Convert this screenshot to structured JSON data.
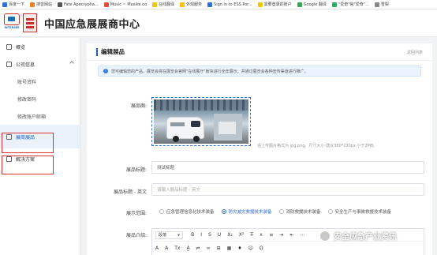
{
  "bookmarks": [
    {
      "label": "百度一下",
      "color": "#2d6fe0",
      "icon": "baidu-icon"
    },
    {
      "label": "搜音网站",
      "color": "#e67e22",
      "icon": "site-icon"
    },
    {
      "label": "Fate Apocrypha...",
      "color": "#555555",
      "icon": "page-icon"
    },
    {
      "label": "Music ~ Musike.co",
      "color": "#e74c3c",
      "icon": "music-icon"
    },
    {
      "label": "在线翻译",
      "color": "#f1c40f",
      "icon": "folder-icon"
    },
    {
      "label": "外观服务",
      "color": "#f1c40f",
      "icon": "folder-icon"
    },
    {
      "label": "Sign in to ESS Por...",
      "color": "#2d6fe0",
      "icon": "signin-icon"
    },
    {
      "label": "需要登录的账户",
      "color": "#f1c40f",
      "icon": "folder-icon"
    },
    {
      "label": "Google 翻译",
      "color": "#34a853",
      "icon": "google-icon"
    },
    {
      "label": "\"爱奇\"官\"爱奇\"...",
      "color": "#27ae60",
      "icon": "video-icon"
    },
    {
      "label": "雪梨",
      "color": "#888888",
      "icon": "page-icon"
    }
  ],
  "header": {
    "logo_text": "INTERSEE",
    "site_title": "中国应急展展商中心"
  },
  "sidebar": {
    "items": [
      {
        "label": "概览"
      },
      {
        "label": "公司信息"
      },
      {
        "label": "账号资料"
      },
      {
        "label": "修改密码"
      },
      {
        "label": "修改账户邮箱"
      },
      {
        "label": "展商展品"
      },
      {
        "label": "解决方案"
      }
    ]
  },
  "page": {
    "title": "编辑展品",
    "back_link": "返回列表",
    "notice": "您可编辑您的产品，展览会将在展览会官网\"在线展厅\"板块进行全年展示；并通过展览会各种宣传渠道进行推广。"
  },
  "form": {
    "image_label": "展品图:",
    "image_hint": "请上传图片格式为 jpg,png。尺寸大小:建议380*230px 小于2MB。",
    "title_label": "展品标题:",
    "title_value": "测试标题",
    "title_en_label": "展品标题 - 英文",
    "title_en_placeholder": "请输入展品标题 - 英文",
    "scope_label": "展示范围:",
    "scope_options": [
      {
        "label": "应急管理信息化技术装备",
        "selected": false
      },
      {
        "label": "防灾减灾救援技术装备",
        "selected": true
      },
      {
        "label": "消防救援技术装备",
        "selected": false
      },
      {
        "label": "安全生产与事故救援技术装备",
        "selected": false
      }
    ],
    "intro_label": "展品介绍:",
    "editor": {
      "paragraph_select": "段落",
      "row1_tools": [
        "B",
        "I",
        "S",
        "U",
        "X₂",
        "X²",
        "T̶",
        "∧",
        "≡",
        "⇥",
        "⇤",
        "⋯"
      ],
      "row2_tools": [
        "A",
        "A",
        "Tx",
        "A̲",
        "⇌",
        "∞",
        "⊞",
        "▦",
        "♦",
        "☺",
        "Ω"
      ],
      "font_size": "A"
    }
  },
  "watermark": {
    "text": "安全应急产业资讯"
  }
}
